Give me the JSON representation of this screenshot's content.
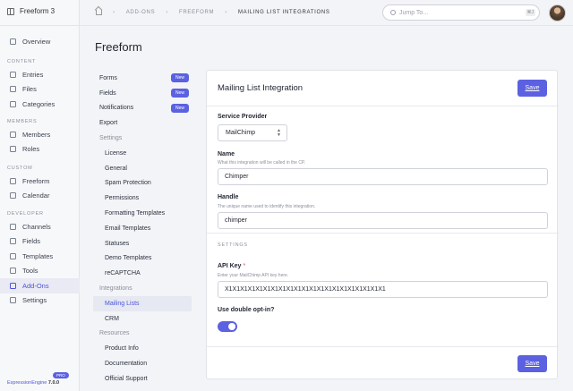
{
  "app": {
    "name": "Freeform 3"
  },
  "sidebar": {
    "top_items": [
      {
        "label": "Overview",
        "icon": "home-icon"
      }
    ],
    "sections": [
      {
        "label": "CONTENT",
        "items": [
          {
            "label": "Entries",
            "icon": "entries-icon"
          },
          {
            "label": "Files",
            "icon": "files-icon"
          },
          {
            "label": "Categories",
            "icon": "tag-icon"
          }
        ]
      },
      {
        "label": "MEMBERS",
        "items": [
          {
            "label": "Members",
            "icon": "members-icon"
          },
          {
            "label": "Roles",
            "icon": "roles-icon"
          }
        ]
      },
      {
        "label": "CUSTOM",
        "items": [
          {
            "label": "Freeform",
            "icon": "freeform-icon"
          },
          {
            "label": "Calendar",
            "icon": "calendar-icon"
          }
        ]
      },
      {
        "label": "DEVELOPER",
        "items": [
          {
            "label": "Channels",
            "icon": "channels-icon"
          },
          {
            "label": "Fields",
            "icon": "fields-icon"
          },
          {
            "label": "Templates",
            "icon": "templates-icon"
          },
          {
            "label": "Tools",
            "icon": "tools-icon"
          },
          {
            "label": "Add-Ons",
            "icon": "addons-icon",
            "active": true
          },
          {
            "label": "Settings",
            "icon": "settings-icon"
          }
        ]
      }
    ],
    "footer": {
      "product": "ExpressionEngine",
      "version": "7.0.0",
      "badge": "PRO"
    }
  },
  "topbar": {
    "breadcrumbs": [
      "ADD-ONS",
      "FREEFORM",
      "MAILING LIST INTEGRATIONS"
    ],
    "separator": "›",
    "jump_placeholder": "Jump To...",
    "jump_shortcut": "⌘J"
  },
  "page": {
    "title": "Freeform"
  },
  "subnav": [
    {
      "label": "Forms",
      "badge": "New",
      "type": "item"
    },
    {
      "label": "Fields",
      "badge": "New",
      "type": "item"
    },
    {
      "label": "Notifications",
      "badge": "New",
      "type": "item"
    },
    {
      "label": "Export",
      "type": "item"
    },
    {
      "label": "Settings",
      "type": "heading"
    },
    {
      "label": "License",
      "type": "sub"
    },
    {
      "label": "General",
      "type": "sub"
    },
    {
      "label": "Spam Protection",
      "type": "sub"
    },
    {
      "label": "Permissions",
      "type": "sub"
    },
    {
      "label": "Formatting Templates",
      "type": "sub"
    },
    {
      "label": "Email Templates",
      "type": "sub"
    },
    {
      "label": "Statuses",
      "type": "sub"
    },
    {
      "label": "Demo Templates",
      "type": "sub"
    },
    {
      "label": "reCAPTCHA",
      "type": "sub"
    },
    {
      "label": "Integrations",
      "type": "heading"
    },
    {
      "label": "Mailing Lists",
      "type": "sub",
      "active": true
    },
    {
      "label": "CRM",
      "type": "sub"
    },
    {
      "label": "Resources",
      "type": "heading"
    },
    {
      "label": "Product Info",
      "type": "sub"
    },
    {
      "label": "Documentation",
      "type": "sub"
    },
    {
      "label": "Official Support",
      "type": "sub"
    }
  ],
  "card": {
    "title": "Mailing List Integration",
    "save_label": "Save",
    "service_provider": {
      "label": "Service Provider",
      "value": "MailChimp"
    },
    "name": {
      "label": "Name",
      "help": "What this integration will be called in the CP.",
      "value": "Chimper"
    },
    "handle": {
      "label": "Handle",
      "help": "The unique name used to identify this integration.",
      "value": "chimper"
    },
    "settings_heading": "SETTINGS",
    "api_key": {
      "label": "API Key",
      "required_mark": "*",
      "help": "Enter your MailChimp API key here.",
      "value": "X1X1X1X1X1X1X1X1X1X1X1X1X1X1X1X1X1X1X1X1X1"
    },
    "double_optin": {
      "label": "Use double opt-in?",
      "enabled": true
    }
  },
  "colors": {
    "accent": "#5b61e0",
    "active_text": "#4d55d6"
  }
}
